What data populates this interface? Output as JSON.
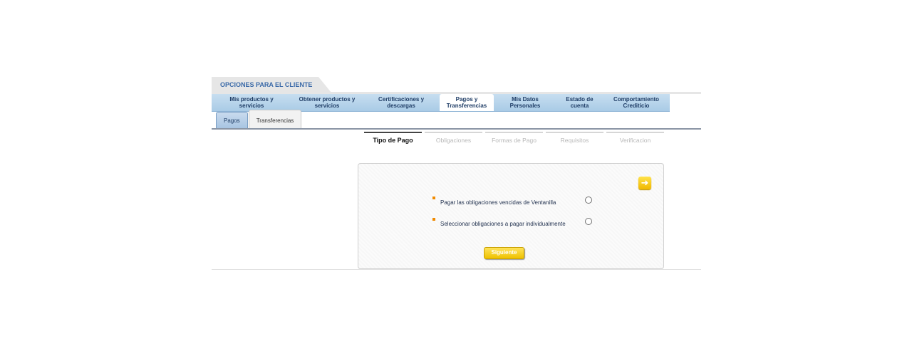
{
  "header": {
    "title": "OPCIONES PARA EL CLIENTE"
  },
  "main_nav": [
    {
      "label": "Mis productos y\nservicios",
      "active": false
    },
    {
      "label": "Obtener productos y\nservicios",
      "active": false
    },
    {
      "label": "Certificaciones y\ndescargas",
      "active": false
    },
    {
      "label": "Pagos y\nTransferencias",
      "active": true
    },
    {
      "label": "Mis Datos\nPersonales",
      "active": false
    },
    {
      "label": "Estado de\ncuenta",
      "active": false
    },
    {
      "label": "Comportamiento\nCrediticio",
      "active": false
    }
  ],
  "sub_tabs": [
    {
      "label": "Pagos",
      "active": true
    },
    {
      "label": "Transferencias",
      "active": false
    }
  ],
  "steps": [
    {
      "label": "Tipo de Pago",
      "active": true
    },
    {
      "label": "Obligaciones",
      "active": false
    },
    {
      "label": "Formas de Pago",
      "active": false
    },
    {
      "label": "Requisitos",
      "active": false
    },
    {
      "label": "Verificacion",
      "active": false
    }
  ],
  "panel": {
    "next_icon": "arrow-right-icon",
    "options": [
      {
        "label": "Pagar las obligaciones vencidas de Ventanilla",
        "selected": false
      },
      {
        "label": "Seleccionar obligaciones a pagar individualmente",
        "selected": false
      }
    ],
    "submit_label": "Siguiente"
  },
  "colors": {
    "accent": "#f0b800",
    "nav": "#a9cbe6",
    "bullet": "#f08a00"
  }
}
